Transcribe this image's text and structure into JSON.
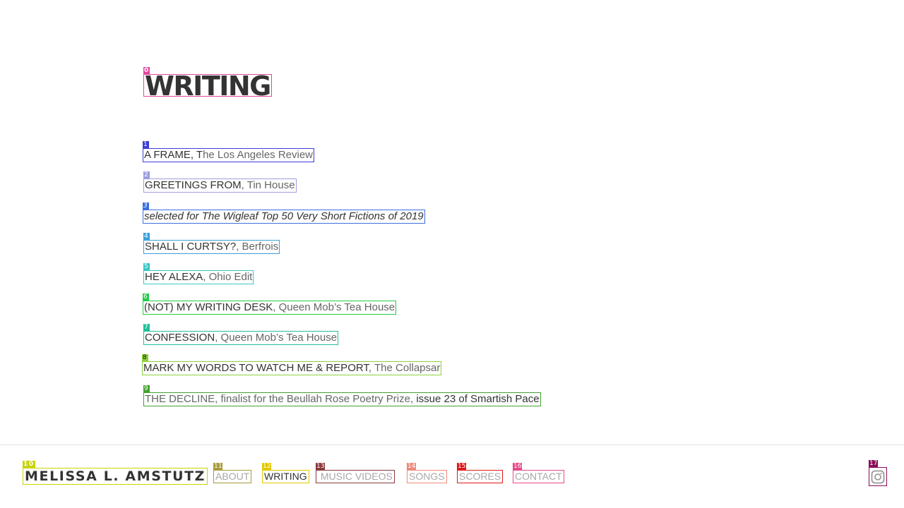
{
  "page": {
    "title": "WRITING"
  },
  "writing": {
    "entries": [
      {
        "title": "A FRAME, T",
        "pub": "he Los Angeles Review"
      },
      {
        "title": "GREETINGS FROM",
        "pub": ", Tin House"
      },
      {
        "text": "selected for The Wigleaf Top 50 Very Short Fictions of 2019"
      },
      {
        "title": "SHALL I CURTSY?",
        "pub": ", Berfrois"
      },
      {
        "title": "HEY ALEXA",
        "pub": ", Ohio Edit"
      },
      {
        "title": "(NOT) MY WRITING DESK",
        "pub": ", Queen Mob’s Tea House"
      },
      {
        "title": "CONFESSION",
        "pub": ", Queen Mob’s Tea House"
      },
      {
        "title": "MARK MY WORDS TO WATCH ME & REPORT",
        "pub": ", The Collapsar"
      },
      {
        "pub": "THE DECLINE, finalist for the Beullah Rose Poetry Prize, ",
        "title": "issue 23 of Smartish Pace"
      }
    ]
  },
  "footer": {
    "site_name": "MELISSA L. AMSTUTZ",
    "nav": {
      "about": "ABOUT",
      "writing": "WRITING",
      "music_videos": " MUSIC VIDEOS",
      "songs": "SONGS",
      "scores": "SCORES",
      "contact": "CONTACT"
    },
    "active_nav": "WRITING",
    "instagram_icon": "instagram-icon"
  },
  "markers": [
    "0",
    "1",
    "2",
    "3",
    "4",
    "5",
    "6",
    "7",
    "8",
    "9",
    "10",
    "11",
    "12",
    "13",
    "14",
    "15",
    "16",
    "17"
  ],
  "colors": {
    "text": "#333333",
    "muted": "#666666",
    "nav_inactive": "#a8a8a8",
    "divider": "#e2e2e2",
    "marker_0": "#e0489a",
    "marker_1": "#3d3dd6",
    "marker_2": "#9d9de0",
    "marker_3": "#3a6fe0",
    "marker_4": "#3aa0d8",
    "marker_5": "#3ac7c7",
    "marker_6": "#22cc44",
    "marker_7": "#22c09a",
    "marker_8": "#8cd23a",
    "marker_9": "#44a030",
    "marker_10": "#c8d400",
    "marker_11": "#a89a3a",
    "marker_12": "#e0c800",
    "marker_13": "#8b3a3a",
    "marker_14": "#f08a7a",
    "marker_15": "#e01818",
    "marker_16": "#e8488a",
    "marker_17": "#8b0a5a"
  }
}
